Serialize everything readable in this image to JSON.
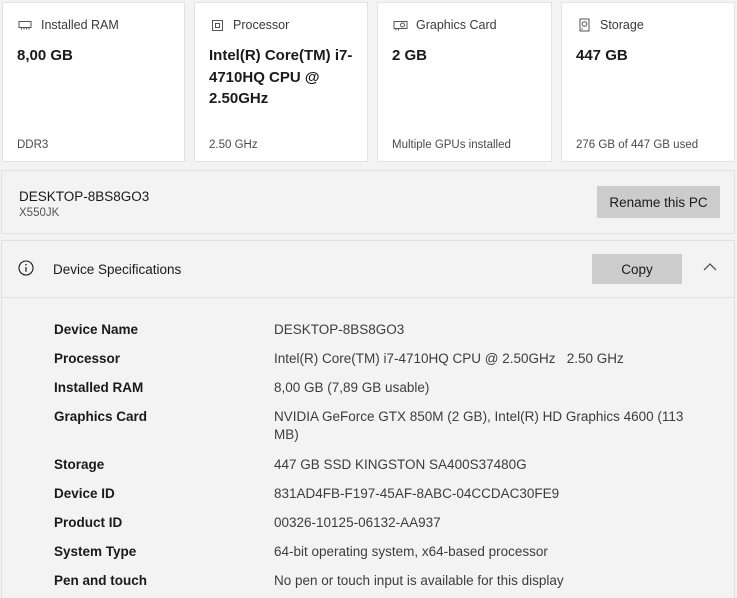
{
  "cards": [
    {
      "title": "Installed RAM",
      "icon": "ram-icon",
      "value": "8,00 GB",
      "sub": "DDR3"
    },
    {
      "title": "Processor",
      "icon": "processor-icon",
      "value": "Intel(R) Core(TM) i7-4710HQ CPU @ 2.50GHz",
      "sub": "2.50 GHz"
    },
    {
      "title": "Graphics Card",
      "icon": "graphics-card-icon",
      "value": "2 GB",
      "sub": "Multiple GPUs installed"
    },
    {
      "title": "Storage",
      "icon": "storage-icon",
      "value": "447 GB",
      "sub": "276 GB of 447 GB used"
    }
  ],
  "pc": {
    "name": "DESKTOP-8BS8GO3",
    "model": "X550JK",
    "rename_label": "Rename this PC"
  },
  "specs": {
    "title": "Device Specifications",
    "copy_label": "Copy",
    "rows": [
      {
        "label": "Device Name",
        "value": "DESKTOP-8BS8GO3"
      },
      {
        "label": "Processor",
        "value": "Intel(R) Core(TM) i7-4710HQ CPU @ 2.50GHz   2.50 GHz"
      },
      {
        "label": "Installed RAM",
        "value": "8,00 GB (7,89 GB usable)"
      },
      {
        "label": "Graphics Card",
        "value": "NVIDIA GeForce GTX 850M (2 GB), Intel(R) HD Graphics 4600 (113 MB)"
      },
      {
        "label": "Storage",
        "value": "447 GB SSD KINGSTON SA400S37480G"
      },
      {
        "label": "Device ID",
        "value": "831AD4FB-F197-45AF-8ABC-04CCDAC30FE9"
      },
      {
        "label": "Product ID",
        "value": "00326-10125-06132-AA937"
      },
      {
        "label": "System Type",
        "value": "64-bit operating system, x64-based processor"
      },
      {
        "label": "Pen and touch",
        "value": "No pen or touch input is available for this display"
      }
    ]
  }
}
